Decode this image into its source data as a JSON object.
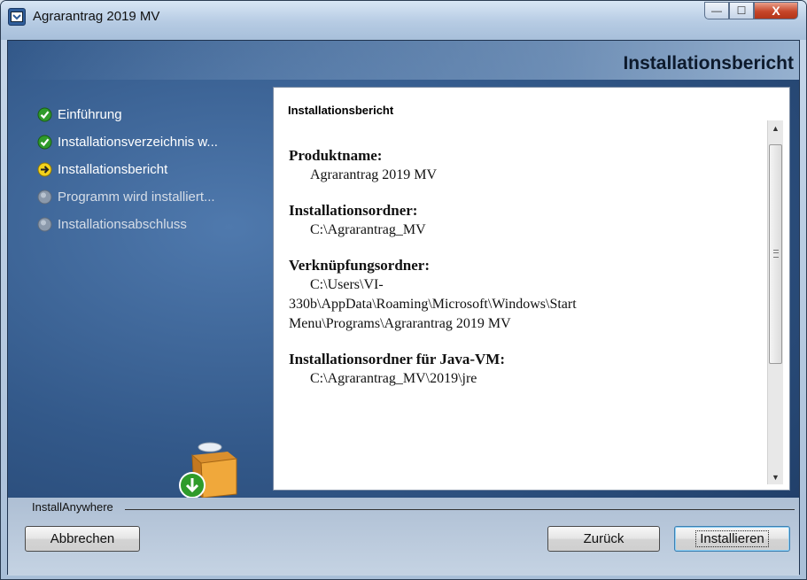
{
  "window": {
    "title": "Agrarantrag 2019 MV",
    "controls": {
      "minimize": "—",
      "maximize": "☐",
      "close": "X"
    }
  },
  "header": {
    "title": "Installationsbericht"
  },
  "steps": [
    {
      "label": "Einführung",
      "state": "done"
    },
    {
      "label": "Installationsverzeichnis w...",
      "state": "done"
    },
    {
      "label": "Installationsbericht",
      "state": "current"
    },
    {
      "label": "Programm wird installiert...",
      "state": "pending"
    },
    {
      "label": "Installationsabschluss",
      "state": "pending"
    }
  ],
  "report": {
    "heading": "Installationsbericht",
    "product_label": "Produktname:",
    "product_value": "Agrarantrag 2019 MV",
    "install_dir_label": "Installationsordner:",
    "install_dir_value": "C:\\Agrarantrag_MV",
    "shortcut_label": "Verknüpfungsordner:",
    "shortcut_line1": "C:\\Users\\VI-",
    "shortcut_line2": "330b\\AppData\\Roaming\\Microsoft\\Windows\\Start",
    "shortcut_line3": "Menu\\Programs\\Agrarantrag 2019 MV",
    "jvm_label": "Installationsordner für Java-VM:",
    "jvm_value": "C:\\Agrarantrag_MV\\2019\\jre"
  },
  "footer": {
    "brand": "InstallAnywhere",
    "cancel_label": "Abbrechen",
    "back_label": "Zurück",
    "install_label": "Installieren"
  },
  "colors": {
    "panel_blue": "#33598a",
    "done_green": "#2f9b2a",
    "current_yellow": "#f2d21c",
    "close_red": "#c6462a"
  }
}
